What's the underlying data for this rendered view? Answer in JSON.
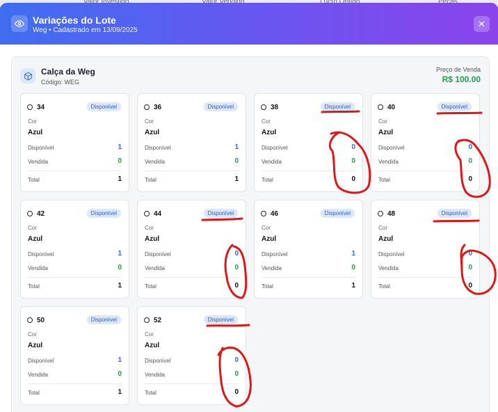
{
  "background": {
    "items": [
      "Valor Investido",
      "Valor Vendido",
      "Lucro Obtido",
      "Peças"
    ]
  },
  "modal": {
    "title": "Variações do Lote",
    "subtitle": "Weg • Cadastrado em 13/09/2025",
    "close_label": "✕"
  },
  "product": {
    "name": "Calça da Weg",
    "code": "Código: WEG",
    "price_label": "Preço de Venda",
    "price_value": "R$ 100.00"
  },
  "labels": {
    "badge": "Disponível",
    "cor": "Cor",
    "disponivel": "Disponível",
    "vendida": "Vendida",
    "total": "Total"
  },
  "variants": [
    {
      "size": "34",
      "cor": "Azul",
      "disponivel": "1",
      "vendida": "0",
      "total": "1"
    },
    {
      "size": "36",
      "cor": "Azul",
      "disponivel": "1",
      "vendida": "0",
      "total": "1"
    },
    {
      "size": "38",
      "cor": "Azul",
      "disponivel": "0",
      "vendida": "0",
      "total": "0"
    },
    {
      "size": "40",
      "cor": "Azul",
      "disponivel": "0",
      "vendida": "0",
      "total": "0"
    },
    {
      "size": "42",
      "cor": "Azul",
      "disponivel": "1",
      "vendida": "0",
      "total": "1"
    },
    {
      "size": "44",
      "cor": "Azul",
      "disponivel": "0",
      "vendida": "0",
      "total": "0"
    },
    {
      "size": "46",
      "cor": "Azul",
      "disponivel": "1",
      "vendida": "0",
      "total": "1"
    },
    {
      "size": "48",
      "cor": "Azul",
      "disponivel": "0",
      "vendida": "0",
      "total": "0"
    },
    {
      "size": "50",
      "cor": "Azul",
      "disponivel": "1",
      "vendida": "0",
      "total": "1"
    },
    {
      "size": "52",
      "cor": "Azul",
      "disponivel": "0",
      "vendida": "0",
      "total": "0"
    }
  ],
  "colors": {
    "header_start": "#3f6ef0",
    "header_end": "#8a44ea",
    "price": "#1f9d55",
    "disponivel_value": "#3569d6",
    "vendida_value": "#1f9d45",
    "annotation": "#e01515"
  }
}
